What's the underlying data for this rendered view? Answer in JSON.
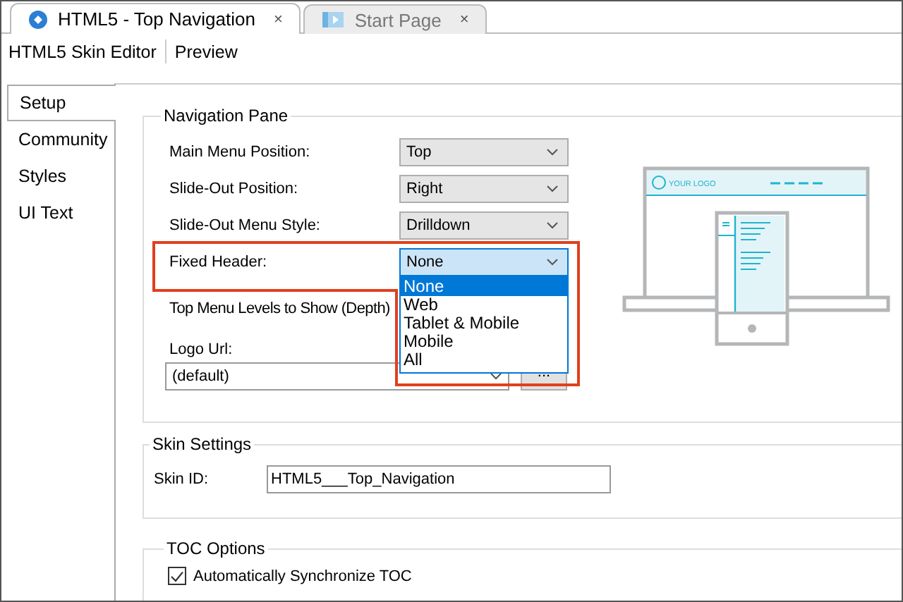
{
  "tabs": [
    {
      "label": "HTML5 - Top Navigation",
      "kind": "project",
      "close": "×",
      "selected": true
    },
    {
      "label": "Start Page",
      "kind": "start",
      "close": "×",
      "selected": false
    }
  ],
  "toolbar": {
    "items": [
      "HTML5 Skin Editor",
      "Preview"
    ]
  },
  "sidebar": {
    "items": [
      {
        "label": "Setup",
        "selected": true
      },
      {
        "label": "Community",
        "selected": false
      },
      {
        "label": "Styles",
        "selected": false
      },
      {
        "label": "UI Text",
        "selected": false
      }
    ]
  },
  "navigation_pane": {
    "title": "Navigation Pane",
    "fields": [
      {
        "kind": "select",
        "label": "Main Menu Position:",
        "value": "Top",
        "focused": false
      },
      {
        "kind": "select",
        "label": "Slide-Out Position:",
        "value": "Right",
        "focused": false
      },
      {
        "kind": "select",
        "label": "Slide-Out Menu Style:",
        "value": "Drilldown",
        "focused": false
      },
      {
        "kind": "select",
        "label": "Fixed Header:",
        "value": "None",
        "focused": true,
        "highlighted": true,
        "options": [
          {
            "label": "None",
            "selected": true
          },
          {
            "label": "Web",
            "selected": false
          },
          {
            "label": "Tablet & Mobile",
            "selected": false
          },
          {
            "label": "Mobile",
            "selected": false
          },
          {
            "label": "All",
            "selected": false
          }
        ]
      },
      {
        "kind": "label",
        "label": "Top Menu Levels to Show (Depth)"
      }
    ],
    "logo": {
      "label": "Logo Url:",
      "value": "(default)",
      "button": "..."
    },
    "preview": {
      "logo_text": "YOUR LOGO"
    }
  },
  "skin_settings": {
    "title": "Skin Settings",
    "label": "Skin ID:",
    "value": "HTML5___Top_Navigation"
  },
  "toc_options": {
    "title": "TOC Options",
    "checkbox": {
      "label": "Automatically Synchronize TOC",
      "checked": true
    }
  }
}
